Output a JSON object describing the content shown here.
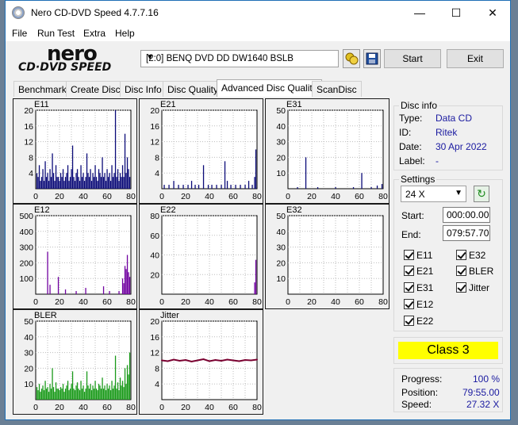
{
  "window": {
    "title": "Nero CD-DVD Speed 4.7.7.16",
    "min": "—",
    "max": "☐",
    "close": "✕"
  },
  "menu": [
    "File",
    "Run Test",
    "Extra",
    "Help"
  ],
  "logo": {
    "line1": "nero",
    "line2": "CD·DVD SPEED"
  },
  "toolbar": {
    "drive": "[2:0]   BENQ DVD DD DW1640 BSLB",
    "start": "Start",
    "exit": "Exit"
  },
  "tabs": [
    "Benchmark",
    "Create Disc",
    "Disc Info",
    "Disc Quality",
    "Advanced Disc Quality",
    "ScanDisc"
  ],
  "disc_info": {
    "title": "Disc info",
    "type_label": "Type:",
    "type": "Data CD",
    "id_label": "ID:",
    "id": "Ritek",
    "date_label": "Date:",
    "date": "30 Apr 2022",
    "label_label": "Label:",
    "label": "-"
  },
  "settings": {
    "title": "Settings",
    "speed": "24 X",
    "start_label": "Start:",
    "start": "000:00.00",
    "end_label": "End:",
    "end": "079:57.70",
    "checks": [
      "E11",
      "E32",
      "E21",
      "BLER",
      "E31",
      "Jitter",
      "E12",
      "E22"
    ]
  },
  "result": {
    "class": "Class 3"
  },
  "progress": {
    "progress_label": "Progress:",
    "progress": "100 %",
    "position_label": "Position:",
    "position": "79:55.00",
    "speed_label": "Speed:",
    "speed": "27.32 X"
  },
  "colors": {
    "navy": "#0b0b78",
    "purple": "#7000a0",
    "green": "#1a9a1a",
    "maroon": "#7a0030",
    "class_bg": "#ffff00"
  },
  "chart_data": [
    {
      "type": "bar",
      "title": "E11",
      "ylim": [
        0,
        20
      ],
      "yticks": [
        20,
        16,
        12,
        8,
        4
      ],
      "xticks": [
        0,
        20,
        40,
        60,
        80
      ],
      "color": "#0b0b78",
      "x": [
        1,
        2,
        3,
        4,
        5,
        6,
        7,
        8,
        9,
        10,
        11,
        12,
        13,
        14,
        15,
        16,
        17,
        18,
        19,
        20,
        21,
        22,
        23,
        24,
        25,
        26,
        27,
        28,
        29,
        30,
        31,
        32,
        33,
        34,
        35,
        36,
        37,
        38,
        39,
        40,
        41,
        42,
        43,
        44,
        45,
        46,
        47,
        48,
        49,
        50,
        51,
        52,
        53,
        54,
        55,
        56,
        57,
        58,
        59,
        60,
        61,
        62,
        63,
        64,
        65,
        66,
        67,
        68,
        69,
        70,
        71,
        72,
        73,
        74,
        75,
        76,
        77,
        78,
        79
      ],
      "values": [
        4,
        3,
        6,
        2,
        3,
        5,
        2,
        7,
        3,
        4,
        2,
        5,
        3,
        9,
        4,
        2,
        6,
        3,
        3,
        2,
        4,
        3,
        5,
        2,
        3,
        4,
        6,
        2,
        3,
        5,
        11,
        3,
        2,
        4,
        5,
        3,
        2,
        6,
        3,
        4,
        2,
        3,
        9,
        4,
        3,
        5,
        2,
        4,
        3,
        6,
        3,
        2,
        5,
        4,
        3,
        8,
        3,
        4,
        2,
        5,
        3,
        4,
        2,
        6,
        3,
        4,
        20,
        3,
        5,
        2,
        4,
        3,
        6,
        3,
        14,
        4,
        8,
        5,
        3
      ]
    },
    {
      "type": "bar",
      "title": "E21",
      "ylim": [
        0,
        20
      ],
      "yticks": [
        20,
        16,
        12,
        8,
        4
      ],
      "xticks": [
        0,
        20,
        40,
        60,
        80
      ],
      "color": "#0b0b78",
      "x": [
        2,
        6,
        10,
        14,
        18,
        22,
        25,
        28,
        31,
        35,
        39,
        42,
        46,
        50,
        53,
        55,
        58,
        62,
        66,
        70,
        73,
        76,
        78,
        79
      ],
      "values": [
        1,
        1,
        2,
        1,
        1,
        1,
        2,
        1,
        1,
        6,
        1,
        1,
        1,
        1,
        7,
        2,
        1,
        1,
        1,
        1,
        2,
        1,
        3,
        10
      ]
    },
    {
      "type": "bar",
      "title": "E31",
      "ylim": [
        0,
        50
      ],
      "yticks": [
        50,
        40,
        30,
        20,
        10
      ],
      "xticks": [
        0,
        20,
        40,
        60,
        80
      ],
      "color": "#0b0b78",
      "x": [
        8,
        15,
        25,
        40,
        55,
        62,
        70,
        75,
        79
      ],
      "values": [
        1,
        20,
        1,
        1,
        1,
        10,
        1,
        2,
        3
      ]
    },
    {
      "type": "bar",
      "title": "E12",
      "ylim": [
        0,
        500
      ],
      "yticks": [
        500,
        400,
        300,
        200,
        100
      ],
      "xticks": [
        0,
        20,
        40,
        60,
        80
      ],
      "color": "#7000a0",
      "x": [
        10,
        12,
        19,
        25,
        34,
        42,
        57,
        62,
        70,
        73,
        74,
        75,
        76,
        77,
        78,
        79
      ],
      "values": [
        270,
        60,
        110,
        30,
        20,
        40,
        50,
        20,
        20,
        100,
        70,
        180,
        160,
        250,
        140,
        110
      ]
    },
    {
      "type": "bar",
      "title": "E22",
      "ylim": [
        0,
        80
      ],
      "yticks": [
        80,
        60,
        40,
        20
      ],
      "xticks": [
        0,
        20,
        40,
        60,
        80
      ],
      "color": "#7000a0",
      "x": [
        78,
        79
      ],
      "values": [
        12,
        35
      ]
    },
    {
      "type": "bar",
      "title": "E32",
      "ylim": [
        0,
        50
      ],
      "yticks": [
        50,
        40,
        30,
        20,
        10
      ],
      "xticks": [
        0,
        20,
        40,
        60,
        80
      ],
      "color": "#7000a0",
      "x": [],
      "values": []
    },
    {
      "type": "bar",
      "title": "BLER",
      "ylim": [
        0,
        50
      ],
      "yticks": [
        50,
        40,
        30,
        20,
        10
      ],
      "xticks": [
        0,
        20,
        40,
        60,
        80
      ],
      "color": "#1a9a1a",
      "x": [
        1,
        2,
        3,
        4,
        5,
        6,
        7,
        8,
        9,
        10,
        11,
        12,
        13,
        14,
        15,
        16,
        17,
        18,
        19,
        20,
        21,
        22,
        23,
        24,
        25,
        26,
        27,
        28,
        29,
        30,
        31,
        32,
        33,
        34,
        35,
        36,
        37,
        38,
        39,
        40,
        41,
        42,
        43,
        44,
        45,
        46,
        47,
        48,
        49,
        50,
        51,
        52,
        53,
        54,
        55,
        56,
        57,
        58,
        59,
        60,
        61,
        62,
        63,
        64,
        65,
        66,
        67,
        68,
        69,
        70,
        71,
        72,
        73,
        74,
        75,
        76,
        77,
        78,
        79
      ],
      "values": [
        8,
        6,
        10,
        5,
        7,
        9,
        6,
        12,
        7,
        8,
        5,
        10,
        7,
        20,
        8,
        5,
        11,
        7,
        7,
        6,
        8,
        7,
        10,
        5,
        7,
        9,
        12,
        6,
        7,
        10,
        18,
        7,
        6,
        9,
        11,
        7,
        6,
        12,
        7,
        9,
        5,
        7,
        18,
        9,
        7,
        10,
        6,
        9,
        7,
        12,
        7,
        6,
        10,
        9,
        7,
        14,
        7,
        9,
        6,
        10,
        7,
        9,
        6,
        12,
        7,
        9,
        28,
        7,
        11,
        6,
        14,
        9,
        12,
        8,
        20,
        10,
        22,
        16,
        30
      ]
    },
    {
      "type": "line",
      "title": "Jitter",
      "ylim": [
        0,
        20
      ],
      "yticks": [
        20,
        16,
        12,
        8,
        4
      ],
      "xticks": [
        0,
        20,
        40,
        60,
        80
      ],
      "color": "#7a0030",
      "x": [
        0,
        5,
        10,
        15,
        20,
        25,
        30,
        35,
        40,
        45,
        50,
        55,
        60,
        65,
        70,
        75,
        80
      ],
      "values": [
        10,
        9.8,
        10.2,
        9.9,
        10.1,
        9.7,
        10.0,
        10.3,
        9.8,
        10.1,
        9.9,
        10.2,
        10.0,
        9.8,
        10.1,
        10.0,
        10.2
      ]
    }
  ]
}
